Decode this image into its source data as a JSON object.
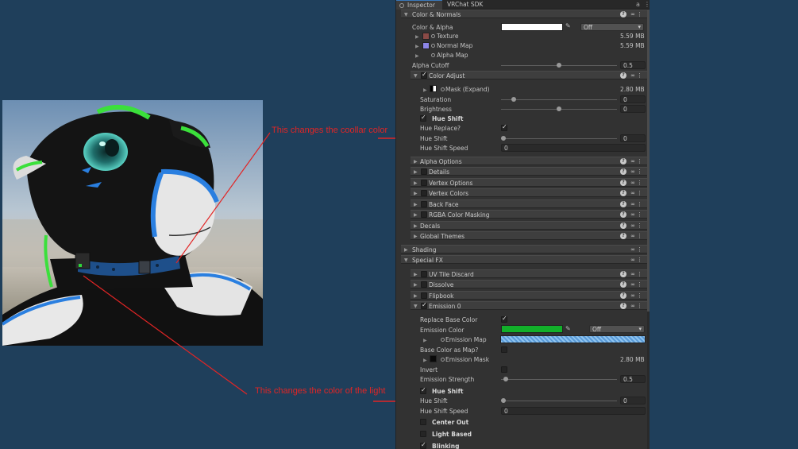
{
  "annotations": {
    "collar_note": "This changes the coollar color",
    "light_note": "This changes the color of the light"
  },
  "tabs": [
    {
      "label": "Inspector",
      "active": true
    },
    {
      "label": "VRChat SDK",
      "active": false
    }
  ],
  "sections": {
    "color_normals": "Color & Normals",
    "shading": "Shading",
    "special_fx": "Special FX"
  },
  "color_alpha": {
    "label": "Color & Alpha",
    "dropdown": "Off",
    "color": "#ffffff",
    "texture_label": "Texture",
    "texture_size": "5.59 MB",
    "normal_label": "Normal Map",
    "normal_size": "5.59 MB",
    "alpha_map_label": "Alpha Map",
    "alpha_cutoff_label": "Alpha Cutoff",
    "alpha_cutoff_value": "0.5",
    "alpha_cutoff_fraction": 0.5
  },
  "color_adjust": {
    "header": "Color Adjust",
    "mask_label": "Mask (Expand)",
    "mask_size": "2.80 MB",
    "saturation_label": "Saturation",
    "saturation_value": "0",
    "brightness_label": "Brightness",
    "brightness_value": "0",
    "hue_shift_toggle": "Hue Shift",
    "hue_replace_label": "Hue Replace?",
    "hue_shift_label": "Hue Shift",
    "hue_shift_value": "0",
    "hue_shift_speed_label": "Hue Shift Speed",
    "hue_shift_speed_value": "0"
  },
  "color_normals_subsections": [
    "Alpha Options",
    "Details",
    "Vertex Options",
    "Vertex Colors",
    "Back Face",
    "RGBA Color Masking",
    "Decals",
    "Global Themes"
  ],
  "special_fx_subsections": [
    "UV Tile Discard",
    "Dissolve",
    "Flipbook"
  ],
  "emission": {
    "header": "Emission 0",
    "replace_base_label": "Replace Base Color",
    "emission_color_label": "Emission Color",
    "emission_color": "#12b02a",
    "emission_dropdown": "Off",
    "emission_map_label": "Emission Map",
    "base_as_map_label": "Base Color as Map?",
    "emission_mask_label": "Emission Mask",
    "emission_mask_size": "2.80 MB",
    "invert_label": "Invert",
    "strength_label": "Emission Strength",
    "strength_value": "0.5",
    "hue_shift_toggle": "Hue Shift",
    "hue_shift_label": "Hue Shift",
    "hue_shift_value": "0",
    "hue_shift_speed_label": "Hue Shift Speed",
    "hue_shift_speed_value": "0",
    "center_out_label": "Center Out",
    "light_based_label": "Light Based",
    "blinking_label": "Blinking"
  },
  "colors": {
    "background": "#1f3f5b",
    "annotation_red": "#e22525",
    "inspector_bg": "#323232"
  }
}
